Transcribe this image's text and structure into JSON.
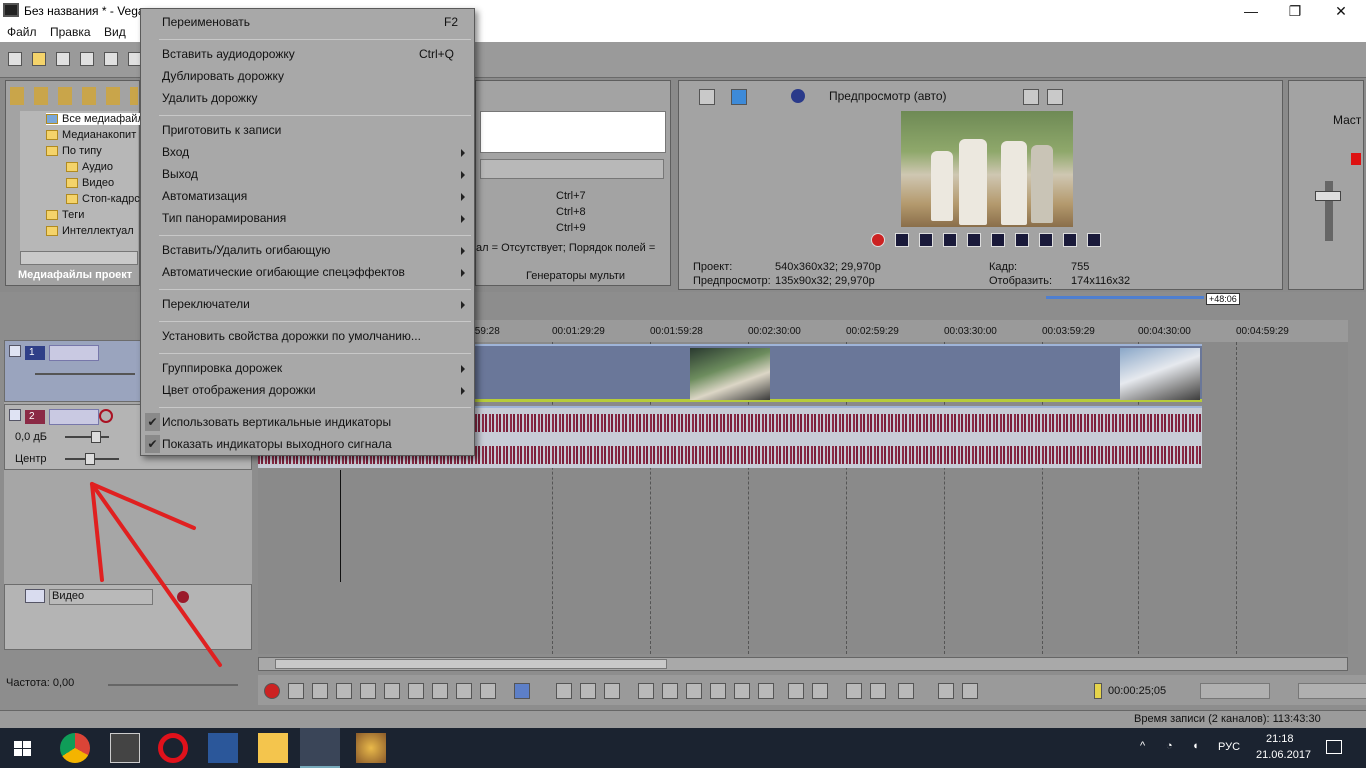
{
  "window": {
    "title": "Без названия * - Vega",
    "controls": {
      "minimize": "—",
      "maximize": "❐",
      "close": "✕"
    }
  },
  "menubar": {
    "items": [
      "Файл",
      "Правка",
      "Вид"
    ]
  },
  "explorer": {
    "tree": [
      {
        "label": "Все медиафайл",
        "level": 0
      },
      {
        "label": "Медианакопит",
        "level": 0
      },
      {
        "label": "По типу",
        "level": 0
      },
      {
        "label": "Аудио",
        "level": 1
      },
      {
        "label": "Видео",
        "level": 1
      },
      {
        "label": "Стоп-кадрс",
        "level": 1
      },
      {
        "label": "Теги",
        "level": 0
      },
      {
        "label": "Интеллектуал",
        "level": 0
      }
    ],
    "tab_label": "Медиафайлы проект"
  },
  "midpanel": {
    "shortcuts": [
      "Ctrl+7",
      "Ctrl+8",
      "Ctrl+9"
    ],
    "props_text": "ал = Отсутствует; Порядок полей =",
    "tab_label": "Генераторы мульти"
  },
  "preview": {
    "mode_label": "Предпросмотр (авто)",
    "project_label": "Проект:",
    "project_value": "540x360x32; 29,970p",
    "preview_label": "Предпросмотр:",
    "preview_value": "135x90x32; 29,970p",
    "frame_label": "Кадр:",
    "frame_value": "755",
    "display_label": "Отобразить:",
    "display_value": "174x116x32"
  },
  "mixer": {
    "label": "Маст"
  },
  "timeline": {
    "marker": "+48:06",
    "ruler_ticks": [
      ":59:28",
      "00:01:29:29",
      "00:01:59:28",
      "00:02:30:00",
      "00:02:59:29",
      "00:03:30:00",
      "00:03:59:29",
      "00:04:30:00",
      "00:04:59:29"
    ],
    "track1_num": "1",
    "track2_num": "2",
    "track2_volume": "0,0 дБ",
    "track2_pan": "Центр",
    "bus_name": "Видео",
    "rate": "Частота: 0,00"
  },
  "transport": {
    "timecode": "00:00:25;05"
  },
  "status": {
    "record_time": "Время записи (2 каналов): 113:43:30"
  },
  "taskbar": {
    "lang": "РУС",
    "time": "21:18",
    "date": "21.06.2017"
  },
  "context_menu": {
    "items": [
      {
        "label": "Переименовать",
        "shortcut": "F2",
        "submenu": false,
        "checked": false
      },
      {
        "label": "Вставить аудиодорожку",
        "shortcut": "Ctrl+Q",
        "submenu": false,
        "checked": false
      },
      {
        "label": "Дублировать дорожку",
        "shortcut": "",
        "submenu": false,
        "checked": false
      },
      {
        "label": "Удалить дорожку",
        "shortcut": "",
        "submenu": false,
        "checked": false
      },
      {
        "label": "Приготовить к записи",
        "shortcut": "",
        "submenu": false,
        "checked": false
      },
      {
        "label": "Вход",
        "shortcut": "",
        "submenu": true,
        "checked": false
      },
      {
        "label": "Выход",
        "shortcut": "",
        "submenu": true,
        "checked": false
      },
      {
        "label": "Автоматизация",
        "shortcut": "",
        "submenu": true,
        "checked": false
      },
      {
        "label": "Тип панорамирования",
        "shortcut": "",
        "submenu": true,
        "checked": false
      },
      {
        "label": "Вставить/Удалить огибающую",
        "shortcut": "",
        "submenu": true,
        "checked": false
      },
      {
        "label": "Автоматические огибающие спецэффектов",
        "shortcut": "",
        "submenu": true,
        "checked": false
      },
      {
        "label": "Переключатели",
        "shortcut": "",
        "submenu": true,
        "checked": false
      },
      {
        "label": "Установить свойства дорожки по умолчанию...",
        "shortcut": "",
        "submenu": false,
        "checked": false
      },
      {
        "label": "Группировка дорожек",
        "shortcut": "",
        "submenu": true,
        "checked": false
      },
      {
        "label": "Цвет отображения дорожки",
        "shortcut": "",
        "submenu": true,
        "checked": false
      },
      {
        "label": "Использовать вертикальные индикаторы",
        "shortcut": "",
        "submenu": false,
        "checked": true
      },
      {
        "label": "Показать индикаторы выходного сигнала",
        "shortcut": "",
        "submenu": false,
        "checked": true
      }
    ]
  },
  "colors": {
    "annotation_arrow": "#e02020",
    "clip_video": "#6a7799",
    "waveform": "#8b2a45"
  }
}
